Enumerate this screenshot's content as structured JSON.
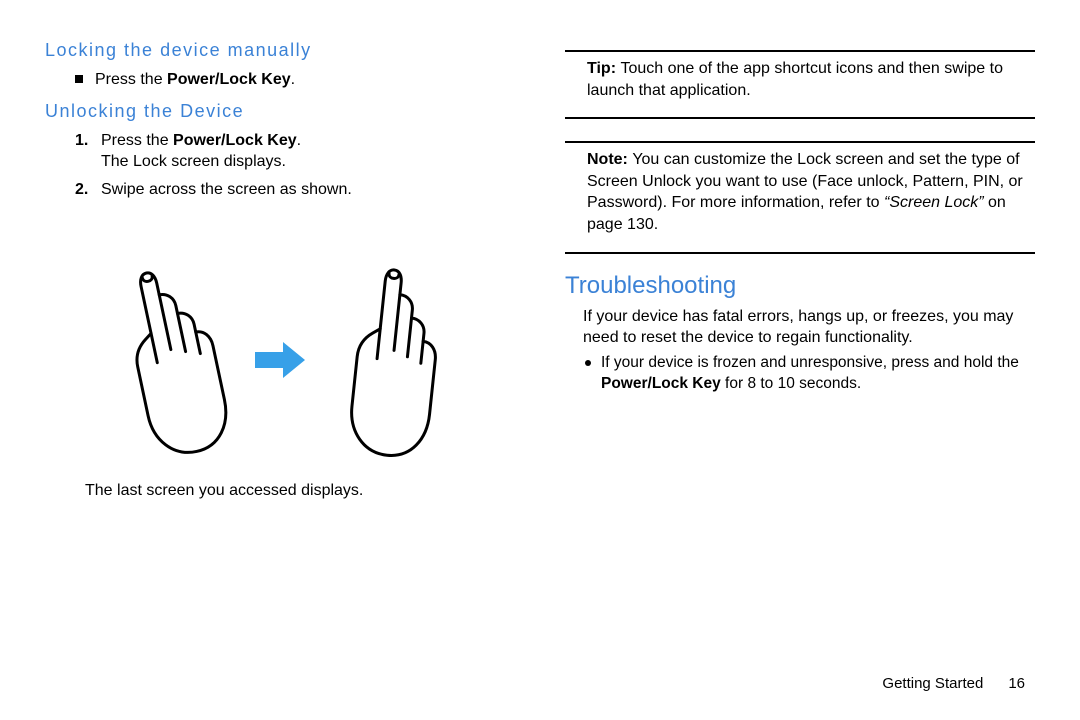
{
  "left": {
    "heading_lock": "Locking the device manually",
    "lock_bullet_pre": "Press the ",
    "lock_bullet_bold": "Power/Lock Key",
    "lock_bullet_post": ".",
    "heading_unlock": "Unlocking the Device",
    "step1_num": "1.",
    "step1_pre": "Press the ",
    "step1_bold": "Power/Lock Key",
    "step1_post": ".",
    "step1_line2": "The Lock screen displays.",
    "step2_num": "2.",
    "step2_text": "Swipe across the screen as shown.",
    "after_illustration": "The last screen you accessed displays."
  },
  "right": {
    "tip_label": "Tip: ",
    "tip_text": "Touch one of the app shortcut icons and then swipe to launch that application.",
    "note_label": "Note: ",
    "note_text": "You can customize the Lock screen and set the type of Screen Unlock you want to use (Face unlock, Pattern, PIN, or Password). For more information, refer to ",
    "note_ref_italic": "“Screen Lock”",
    "note_ref_tail": " on page 130.",
    "troubleshoot_heading": "Troubleshooting",
    "troubleshoot_intro": "If your device has fatal errors, hangs up, or freezes, you may need to reset the device to regain functionality.",
    "troubleshoot_bullet_pre": "If your device is frozen and unresponsive, press and hold the ",
    "troubleshoot_bullet_bold": "Power/Lock Key",
    "troubleshoot_bullet_post": " for 8 to 10 seconds."
  },
  "footer": {
    "section": "Getting Started",
    "page": "16"
  }
}
